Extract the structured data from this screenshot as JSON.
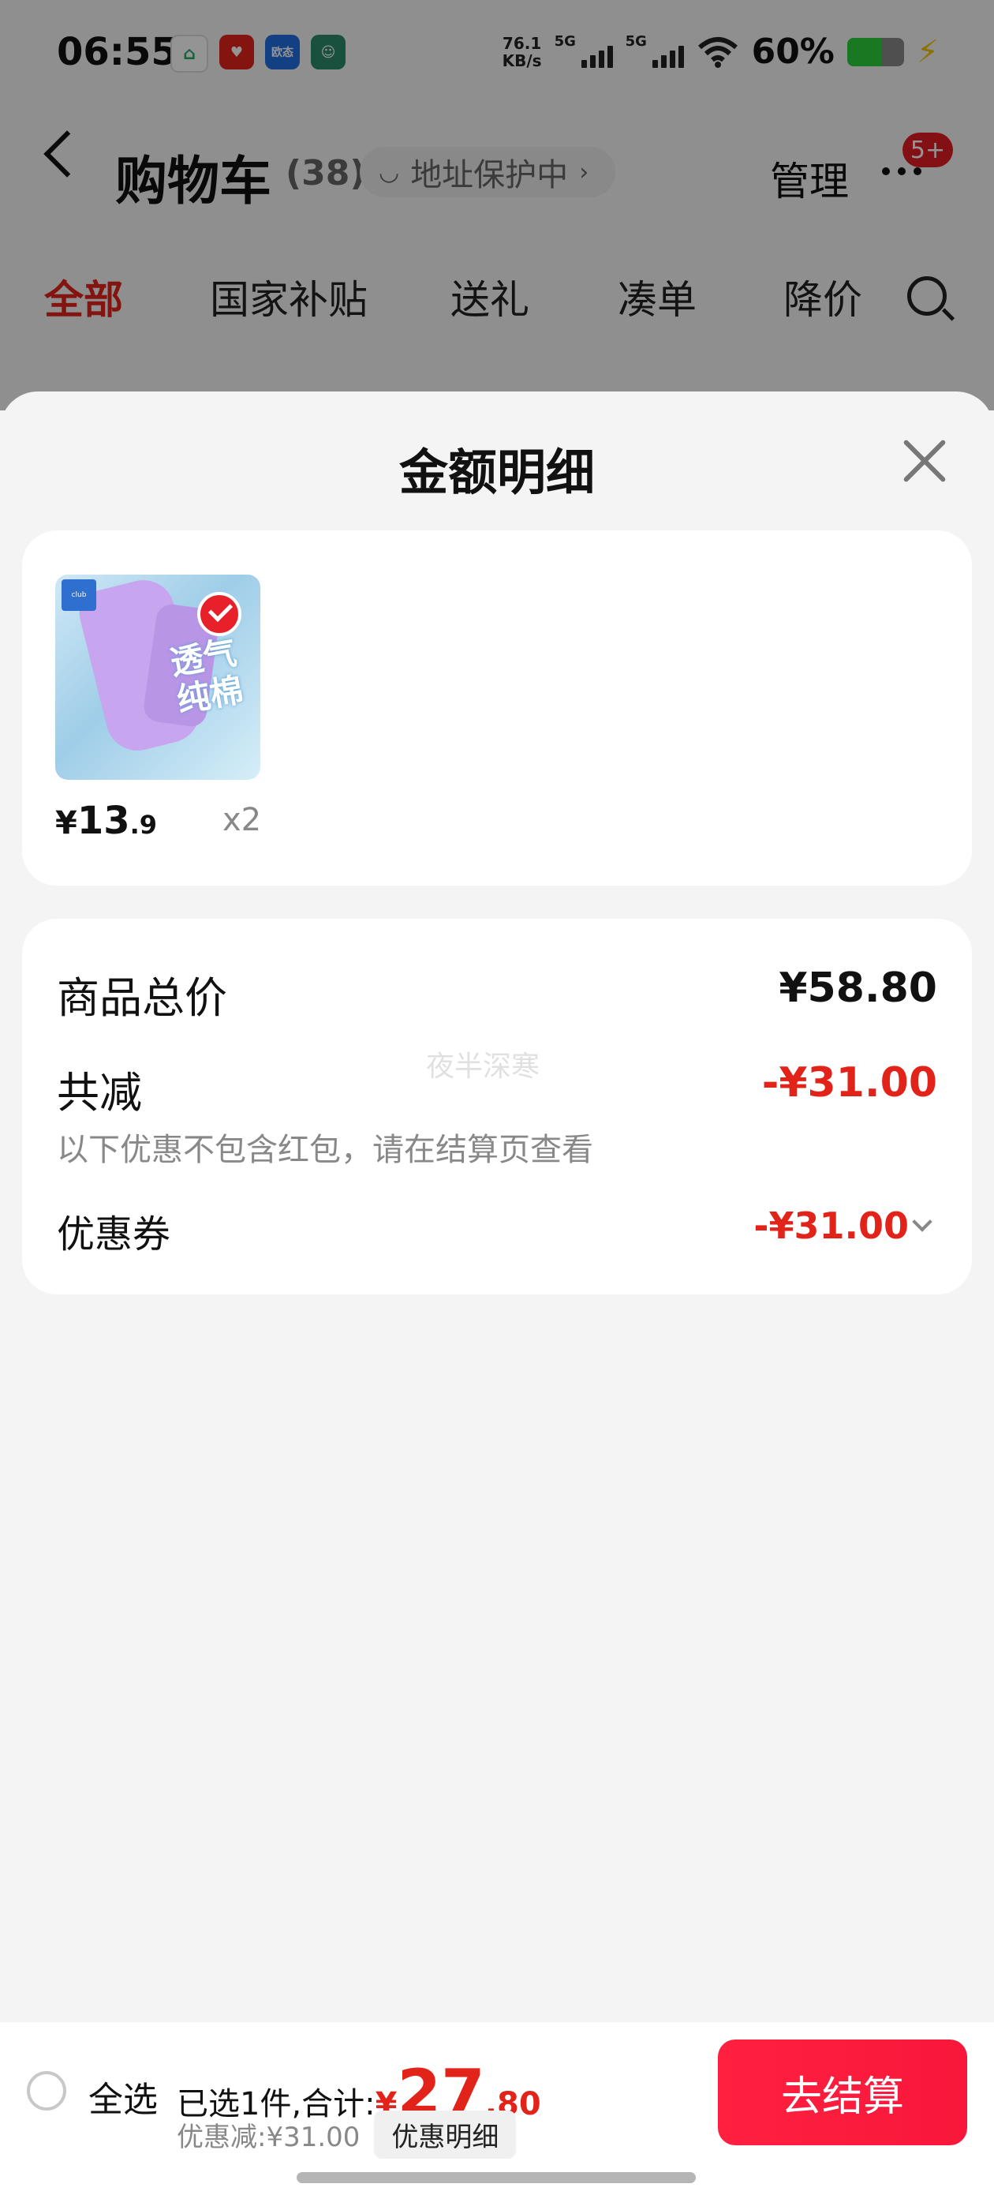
{
  "status_bar": {
    "time": "06:55",
    "app_icons": [
      "home-app-icon",
      "heart-app-icon",
      "oppo-app-icon",
      "avatar-app-icon"
    ],
    "app_icon_label": "欧态",
    "net_speed_value": "76.1",
    "net_speed_unit": "KB/s",
    "signal_1_label": "5G",
    "signal_2_label": "5G",
    "battery_percent_text": "60%",
    "battery_level": 0.6
  },
  "nav": {
    "title": "购物车",
    "count": "(38)",
    "address_label": "地址保护中",
    "manage_label": "管理",
    "badge": "5+"
  },
  "tabs": [
    {
      "label": "全部",
      "active": true
    },
    {
      "label": "国家补贴",
      "active": false
    },
    {
      "label": "送礼",
      "active": false
    },
    {
      "label": "凑单",
      "active": false
    },
    {
      "label": "降价",
      "active": false
    }
  ],
  "sheet": {
    "title": "金额明细",
    "item": {
      "price_symbol": "¥",
      "price_int": "13",
      "price_dec": ".9",
      "qty": "x2",
      "image_text": "透气纯棉"
    },
    "summary": {
      "total_label": "商品总价",
      "total_value": "¥58.80",
      "reduce_label": "共减",
      "reduce_value": "-¥31.00",
      "reduce_note": "以下优惠不包含红包，请在结算页查看",
      "coupon_label": "优惠券",
      "coupon_value": "-¥31.00",
      "watermark": "夜半深寒"
    }
  },
  "bottom_bar": {
    "select_all_label": "全选",
    "selected_text": "已选1件,合计:",
    "total_symbol": "¥",
    "total_int": "27",
    "total_dec": ".80",
    "discount_text": "优惠减:¥31.00",
    "detail_chip_label": "优惠明细",
    "checkout_label": "去结算"
  },
  "colors": {
    "accent_red": "#e2231a",
    "checkout_red": "#ff2040",
    "battery_green": "#2bd13c"
  }
}
